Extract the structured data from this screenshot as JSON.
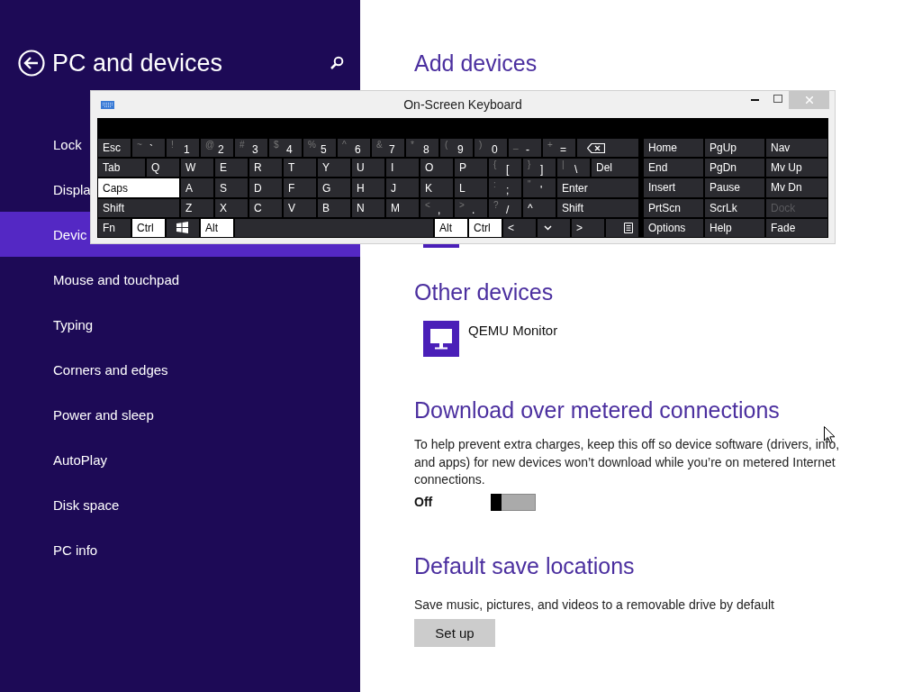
{
  "sidebar": {
    "title": "PC and devices",
    "items": [
      {
        "label": "Lock",
        "selected": false
      },
      {
        "label": "Displa",
        "selected": false
      },
      {
        "label": "Devic",
        "selected": true
      },
      {
        "label": "Mouse and touchpad",
        "selected": false
      },
      {
        "label": "Typing",
        "selected": false
      },
      {
        "label": "Corners and edges",
        "selected": false
      },
      {
        "label": "Power and sleep",
        "selected": false
      },
      {
        "label": "AutoPlay",
        "selected": false
      },
      {
        "label": "Disk space",
        "selected": false
      },
      {
        "label": "PC info",
        "selected": false
      }
    ]
  },
  "main": {
    "add_devices": {
      "heading": "Add devices"
    },
    "other_devices": {
      "heading": "Other devices",
      "devices": [
        {
          "name": "QEMU Monitor"
        }
      ]
    },
    "metered": {
      "heading": "Download over metered connections",
      "description": "To help prevent extra charges, keep this off so device software (drivers, info, and apps) for new devices won’t download while you’re on metered Internet connections.",
      "toggle": {
        "label": "Off",
        "on": false
      }
    },
    "save_locations": {
      "heading": "Default save locations",
      "description": "Save music, pictures, and videos to a removable drive by default",
      "button": "Set up"
    }
  },
  "keyboard_window": {
    "title": "On-Screen Keyboard",
    "rows": [
      [
        {
          "kind": "key",
          "label": "Esc"
        },
        {
          "kind": "dual",
          "shift": "~",
          "label": "`"
        },
        {
          "kind": "dual",
          "shift": "!",
          "label": "1"
        },
        {
          "kind": "dual",
          "shift": "@",
          "label": "2"
        },
        {
          "kind": "dual",
          "shift": "#",
          "label": "3"
        },
        {
          "kind": "dual",
          "shift": "$",
          "label": "4"
        },
        {
          "kind": "dual",
          "shift": "%",
          "label": "5"
        },
        {
          "kind": "dual",
          "shift": "^",
          "label": "6"
        },
        {
          "kind": "dual",
          "shift": "&",
          "label": "7"
        },
        {
          "kind": "dual",
          "shift": "*",
          "label": "8"
        },
        {
          "kind": "dual",
          "shift": "(",
          "label": "9"
        },
        {
          "kind": "dual",
          "shift": ")",
          "label": "0"
        },
        {
          "kind": "dual",
          "shift": "_",
          "label": "-"
        },
        {
          "kind": "dual",
          "shift": "+",
          "label": "="
        },
        {
          "kind": "backspace"
        }
      ],
      [
        {
          "kind": "key",
          "label": "Tab"
        },
        {
          "kind": "key",
          "label": "Q"
        },
        {
          "kind": "key",
          "label": "W"
        },
        {
          "kind": "key",
          "label": "E"
        },
        {
          "kind": "key",
          "label": "R"
        },
        {
          "kind": "key",
          "label": "T"
        },
        {
          "kind": "key",
          "label": "Y"
        },
        {
          "kind": "key",
          "label": "U"
        },
        {
          "kind": "key",
          "label": "I"
        },
        {
          "kind": "key",
          "label": "O"
        },
        {
          "kind": "key",
          "label": "P"
        },
        {
          "kind": "dual",
          "shift": "{",
          "label": "["
        },
        {
          "kind": "dual",
          "shift": "}",
          "label": "]"
        },
        {
          "kind": "dual",
          "shift": "|",
          "label": "\\"
        },
        {
          "kind": "key",
          "label": "Del"
        }
      ],
      [
        {
          "kind": "toggle",
          "label": "Caps",
          "on": true
        },
        {
          "kind": "key",
          "label": "A"
        },
        {
          "kind": "key",
          "label": "S"
        },
        {
          "kind": "key",
          "label": "D"
        },
        {
          "kind": "key",
          "label": "F"
        },
        {
          "kind": "key",
          "label": "G"
        },
        {
          "kind": "key",
          "label": "H"
        },
        {
          "kind": "key",
          "label": "J"
        },
        {
          "kind": "key",
          "label": "K"
        },
        {
          "kind": "key",
          "label": "L"
        },
        {
          "kind": "dual",
          "shift": ":",
          "label": ";"
        },
        {
          "kind": "dual",
          "shift": "\"",
          "label": "'"
        },
        {
          "kind": "key",
          "label": "Enter"
        }
      ],
      [
        {
          "kind": "toggle",
          "label": "Shift",
          "on": false
        },
        {
          "kind": "key",
          "label": "Z"
        },
        {
          "kind": "key",
          "label": "X"
        },
        {
          "kind": "key",
          "label": "C"
        },
        {
          "kind": "key",
          "label": "V"
        },
        {
          "kind": "key",
          "label": "B"
        },
        {
          "kind": "key",
          "label": "N"
        },
        {
          "kind": "key",
          "label": "M"
        },
        {
          "kind": "dual",
          "shift": "<",
          "label": ","
        },
        {
          "kind": "dual",
          "shift": ">",
          "label": "."
        },
        {
          "kind": "dual",
          "shift": "?",
          "label": "/"
        },
        {
          "kind": "key",
          "label": "^"
        },
        {
          "kind": "toggle",
          "label": "Shift",
          "on": false
        }
      ],
      [
        {
          "kind": "toggle",
          "label": "Fn",
          "on": false
        },
        {
          "kind": "toggle",
          "label": "Ctrl",
          "on": true
        },
        {
          "kind": "windows"
        },
        {
          "kind": "toggle",
          "label": "Alt",
          "on": true
        },
        {
          "kind": "space"
        },
        {
          "kind": "toggle",
          "label": "Alt",
          "on": true
        },
        {
          "kind": "toggle",
          "label": "Ctrl",
          "on": true
        },
        {
          "kind": "key",
          "label": "<"
        },
        {
          "kind": "down"
        },
        {
          "kind": "key",
          "label": ">"
        },
        {
          "kind": "menu"
        }
      ]
    ],
    "nav_keys": [
      {
        "label": "Home",
        "disabled": false
      },
      {
        "label": "PgUp",
        "disabled": false
      },
      {
        "label": "Nav",
        "disabled": false
      },
      {
        "label": "End",
        "disabled": false
      },
      {
        "label": "PgDn",
        "disabled": false
      },
      {
        "label": "Mv Up",
        "disabled": false
      },
      {
        "label": "Insert",
        "disabled": false
      },
      {
        "label": "Pause",
        "disabled": false
      },
      {
        "label": "Mv Dn",
        "disabled": false
      },
      {
        "label": "PrtScn",
        "disabled": false
      },
      {
        "label": "ScrLk",
        "disabled": false
      },
      {
        "label": "Dock",
        "disabled": true
      },
      {
        "label": "Options",
        "disabled": false
      },
      {
        "label": "Help",
        "disabled": false
      },
      {
        "label": "Fade",
        "disabled": false
      }
    ]
  }
}
